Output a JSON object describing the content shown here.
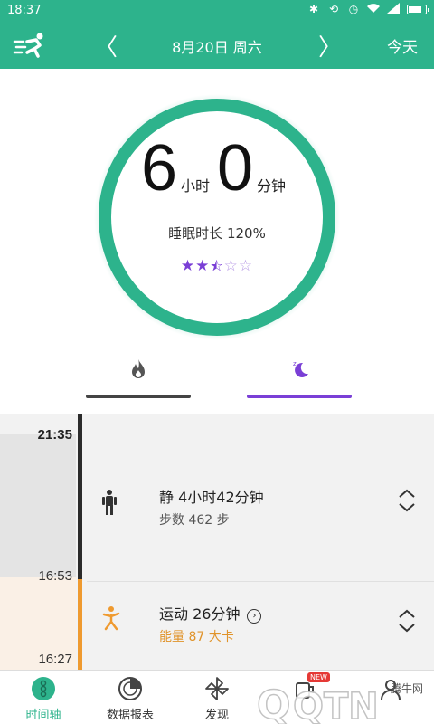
{
  "status_bar": {
    "time": "18:37"
  },
  "header": {
    "prev_symbol": "〈",
    "next_symbol": "〉",
    "date": "8月20日 周六",
    "today_label": "今天"
  },
  "summary": {
    "hours": "6",
    "hours_unit": "小时",
    "minutes": "0",
    "minutes_unit": "分钟",
    "sleep_ratio": "睡眠时长 120%",
    "rating": 2.5,
    "rating_max": 5,
    "ring_color": "#2db38c"
  },
  "tabs": [
    {
      "icon": "flame-icon",
      "active": false
    },
    {
      "icon": "moon-icon",
      "active": true,
      "color": "#7a3fd6"
    }
  ],
  "timeline": {
    "times": [
      "21:35",
      "16:53",
      "16:27"
    ],
    "entries": [
      {
        "title": "静 4小时42分钟",
        "subtitle": "步数 462 步",
        "icon": "standing-person-icon",
        "color": "#2b2b2b"
      },
      {
        "title": "运动 26分钟",
        "subtitle": "能量 87 大卡",
        "icon": "running-person-icon",
        "color": "#ef9a2f"
      }
    ]
  },
  "bottom_nav": [
    {
      "label": "时间轴",
      "icon": "timeline-icon",
      "active": true
    },
    {
      "label": "数据报表",
      "icon": "report-disc-icon",
      "active": false
    },
    {
      "label": "发现",
      "icon": "pinwheel-icon",
      "active": false
    },
    {
      "label": "",
      "icon": "cup-icon",
      "badge": "NEW",
      "active": false
    },
    {
      "label": "",
      "icon": "profile-icon",
      "active": false
    }
  ],
  "watermark": {
    "text": "腾牛网",
    "logo": "QQTN.com"
  }
}
